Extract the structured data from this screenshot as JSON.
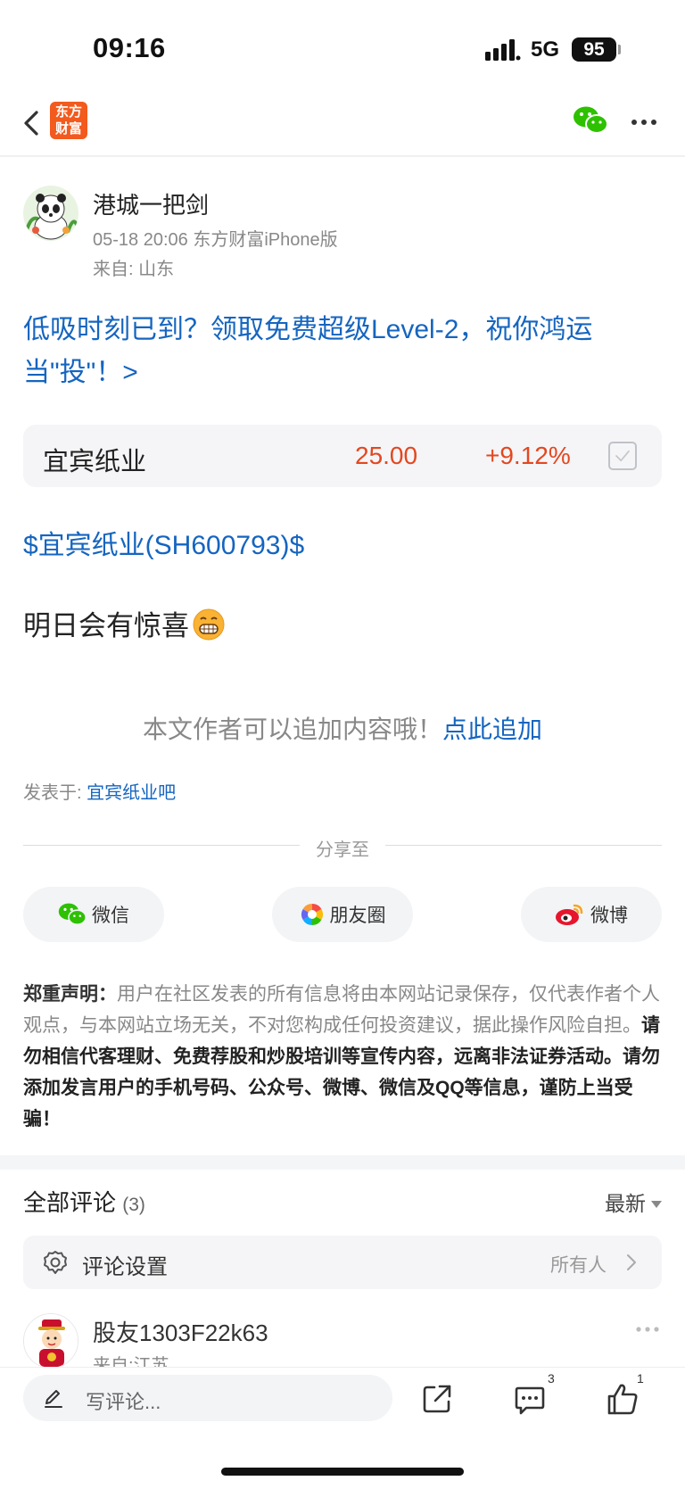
{
  "status_bar": {
    "time": "09:16",
    "network": "5G",
    "battery": "95"
  },
  "navbar": {
    "logo_line1": "东方",
    "logo_line2": "财富"
  },
  "author": {
    "name": "港城一把剑",
    "meta": "05-18 20:06 东方财富iPhone版",
    "from": "来自: 山东"
  },
  "promo_text": "低吸时刻已到？领取免费超级Level-2，祝你鸿运当\"投\"！>",
  "stock": {
    "name": "宜宾纸业",
    "price": "25.00",
    "change": "+9.12%"
  },
  "post": {
    "stock_tag": "$宜宾纸业(SH600793)$",
    "content": "明日会有惊喜"
  },
  "append": {
    "text": "本文作者可以追加内容哦！",
    "link": "点此追加"
  },
  "posted_in": {
    "label": "发表于: ",
    "bar": "宜宾纸业吧"
  },
  "share": {
    "label": "分享至",
    "wechat": "微信",
    "moments": "朋友圈",
    "weibo": "微博"
  },
  "disclaimer": {
    "title": "郑重声明：",
    "normal": "用户在社区发表的所有信息将由本网站记录保存，仅代表作者个人观点，与本网站立场无关，不对您构成任何投资建议，据此操作风险自担。",
    "bold": "请勿相信代客理财、免费荐股和炒股培训等宣传内容，远离非法证券活动。请勿添加发言用户的手机号码、公众号、微博、微信及QQ等信息，谨防上当受骗！"
  },
  "comments": {
    "title": "全部评论",
    "count": "(3)",
    "sort": "最新",
    "settings_label": "评论设置",
    "settings_value": "所有人",
    "first_comment": {
      "name": "股友1303F22k63",
      "from": "来自:江苏"
    }
  },
  "bottom_bar": {
    "placeholder": "写评论...",
    "comment_count": "3",
    "like_count": "1"
  },
  "colors": {
    "link_blue": "#1565c0",
    "rise_red": "#e4471f",
    "brand_orange": "#f35a1d",
    "wechat_green": "#2dc100"
  }
}
